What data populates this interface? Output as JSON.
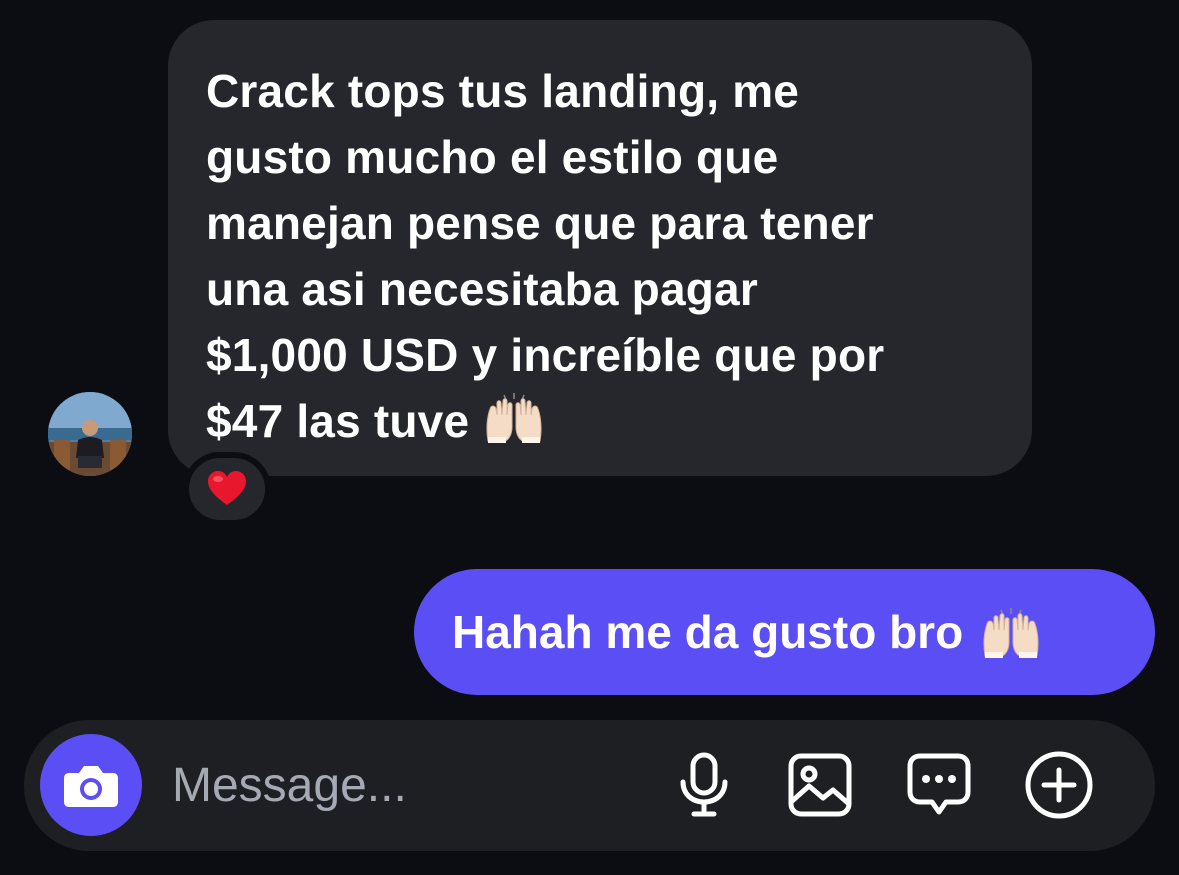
{
  "incoming": {
    "lines": [
      "Crack tops tus landing, me",
      "gusto mucho el estilo que",
      "manejan pense que para tener",
      "una asi necesitaba pagar",
      "$1,000 USD y increíble que por",
      "$47 las tuve"
    ],
    "emoji": "raising-hands-emoji",
    "reaction": "red-heart-emoji"
  },
  "outgoing": {
    "text": "Hahah me da gusto bro",
    "emoji": "raising-hands-emoji"
  },
  "composer": {
    "placeholder": "Message...",
    "icons": [
      "camera-icon",
      "microphone-icon",
      "image-icon",
      "chat-bubble-icon",
      "plus-circle-icon"
    ]
  },
  "colors": {
    "background": "#0c0d12",
    "incoming_bubble": "#26272c",
    "accent": "#5b4ef5",
    "composer": "#1e1f23",
    "placeholder": "#a4a9b4"
  }
}
